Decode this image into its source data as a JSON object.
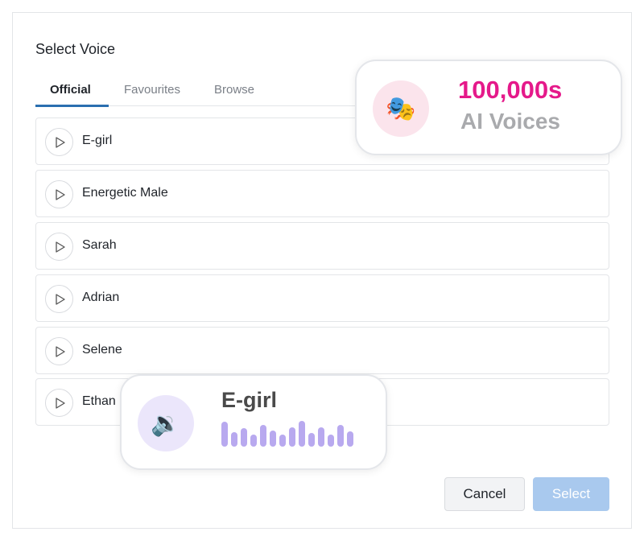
{
  "dialog": {
    "title": "Select Voice"
  },
  "tabs": [
    {
      "label": "Official",
      "active": true
    },
    {
      "label": "Favourites",
      "active": false
    },
    {
      "label": "Browse",
      "active": false
    }
  ],
  "voices": [
    {
      "name": "E-girl"
    },
    {
      "name": "Energetic Male"
    },
    {
      "name": "Sarah"
    },
    {
      "name": "Adrian"
    },
    {
      "name": "Selene"
    },
    {
      "name": "Ethan"
    }
  ],
  "actions": {
    "cancel_label": "Cancel",
    "select_label": "Select"
  },
  "promo_card": {
    "count": "100,000s",
    "subtitle": "AI Voices",
    "icon": "theater-masks-icon",
    "icon_glyph": "🎭"
  },
  "now_playing_card": {
    "name": "E-girl",
    "icon": "speaker-icon",
    "icon_glyph": "🔉"
  },
  "colors": {
    "accent": "#2b6fb0",
    "promo_count": "#e5198a",
    "select_disabled": "#a9c9ee",
    "waveform": "#b8a9ef"
  }
}
